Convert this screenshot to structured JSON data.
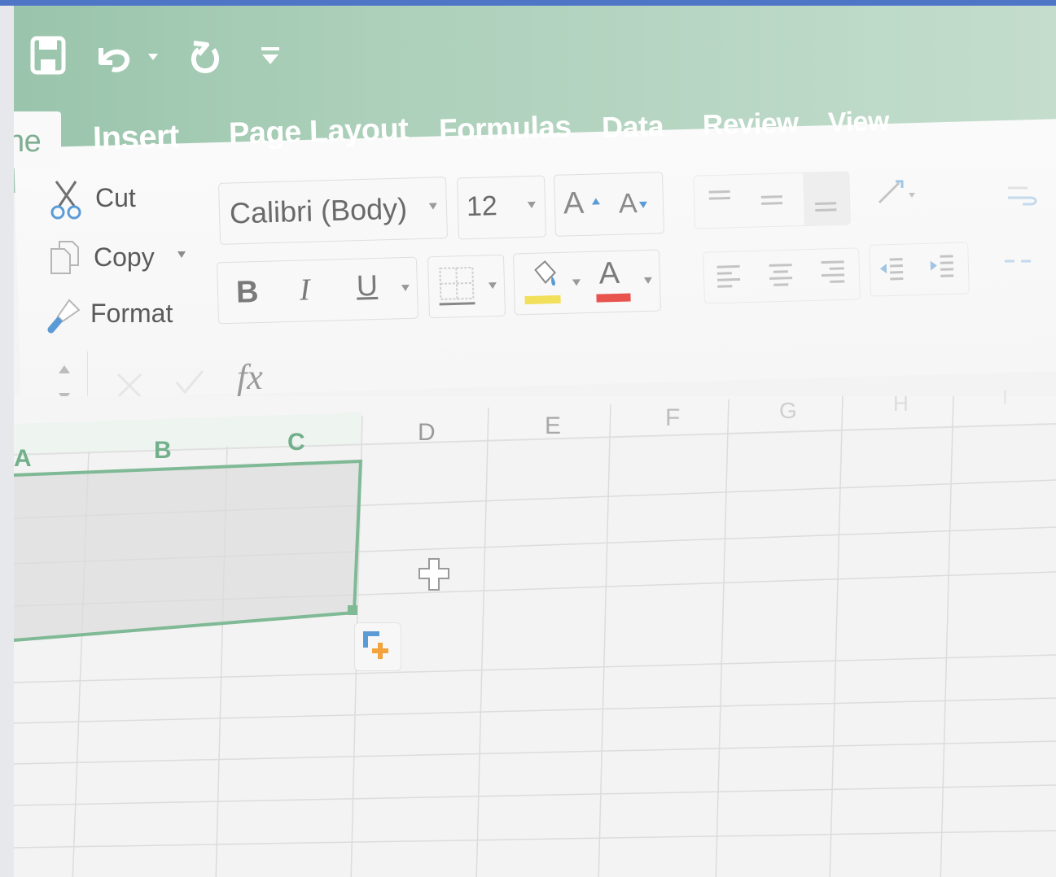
{
  "quick_access": {
    "save_icon": "floppy-disk-icon",
    "undo_icon": "undo-arrow-icon",
    "undo_dropdown_icon": "chevron-down-icon",
    "redo_icon": "redo-arrow-icon",
    "customize_icon": "customize-toolbar-icon"
  },
  "tabs": [
    {
      "label": "ne"
    },
    {
      "label": "Insert"
    },
    {
      "label": "Page Layout"
    },
    {
      "label": "Formulas"
    },
    {
      "label": "Data"
    },
    {
      "label": "Review"
    },
    {
      "label": "View"
    }
  ],
  "clipboard": {
    "cut_label": "Cut",
    "copy_label": "Copy",
    "format_label": "Format"
  },
  "font": {
    "name_value": "Calibri (Body)",
    "size_value": "12",
    "grow_label": "A",
    "shrink_label": "A",
    "bold_label": "B",
    "italic_label": "I",
    "underline_label": "U",
    "font_color_label": "A",
    "highlight_color": "#f2e05a",
    "font_color": "#e8534d"
  },
  "formula_bar": {
    "fx_label": "fx",
    "value": ""
  },
  "sheet": {
    "columns": [
      "A",
      "B",
      "C",
      "D",
      "E",
      "F",
      "G",
      "H",
      "I"
    ],
    "selected_columns": [
      "A",
      "B",
      "C"
    ],
    "accent": "#7fb995"
  },
  "colors": {
    "accent_green": "#9ac4ac",
    "title_strip": "#4f76c6"
  }
}
